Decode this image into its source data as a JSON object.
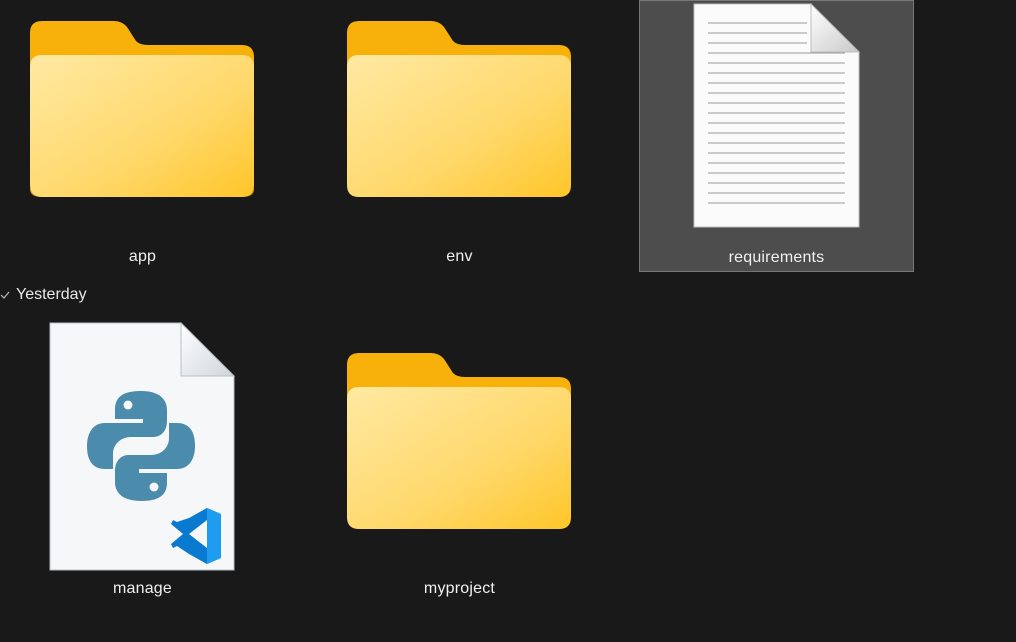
{
  "items_top": [
    {
      "name": "app",
      "type": "folder"
    },
    {
      "name": "env",
      "type": "folder"
    },
    {
      "name": "requirements",
      "type": "text-file",
      "selected": true
    }
  ],
  "group": {
    "label": "Yesterday",
    "icon": "check-chevron-icon"
  },
  "items_yesterday": [
    {
      "name": "manage",
      "type": "python-file"
    },
    {
      "name": "myproject",
      "type": "folder"
    }
  ],
  "colors": {
    "background": "#191919",
    "selection": "#4d4d4d",
    "folder_back": "#f5b400",
    "folder_front": "#ffd35c",
    "python_blue": "#4b8bab",
    "vscode_blue": "#0a7ad1"
  }
}
